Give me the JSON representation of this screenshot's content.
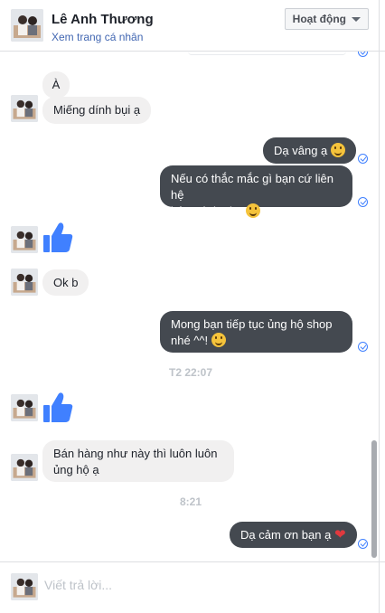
{
  "header": {
    "name": "Lê Anh Thương",
    "profile_link": "Xem trang cá nhân",
    "status_button": "Hoạt động"
  },
  "messages": {
    "m1": "À",
    "m2": "Miếng dính bụi ạ",
    "m3": "Dạ vâng ạ",
    "m4_line1": "Nếu có thắc mắc gì bạn cứ liên hệ",
    "m4_line2": "bên mình nha",
    "m5": "Ok b",
    "m6_line1": "Mong bạn tiếp tục ủng hộ shop",
    "m6_line2": "nhé ^^!",
    "m7_line1": "Bán hàng như này thì luôn luôn",
    "m7_line2": "ủng hộ ạ",
    "m8": "Dạ cảm ơn bạn ạ"
  },
  "timestamps": {
    "t1": "T2 22:07",
    "t2": "8:21"
  },
  "composer": {
    "placeholder": "Viết trả lời..."
  },
  "colors": {
    "outgoing_bubble": "#444950",
    "incoming_bubble": "#f1f0f0",
    "like_blue": "#4080ff",
    "link_blue": "#4267b2"
  },
  "icons": {
    "like": "thumbs-up-icon",
    "smile": "smile-emoji-icon",
    "heart": "heart-emoji-icon",
    "seen": "seen-check-icon"
  }
}
